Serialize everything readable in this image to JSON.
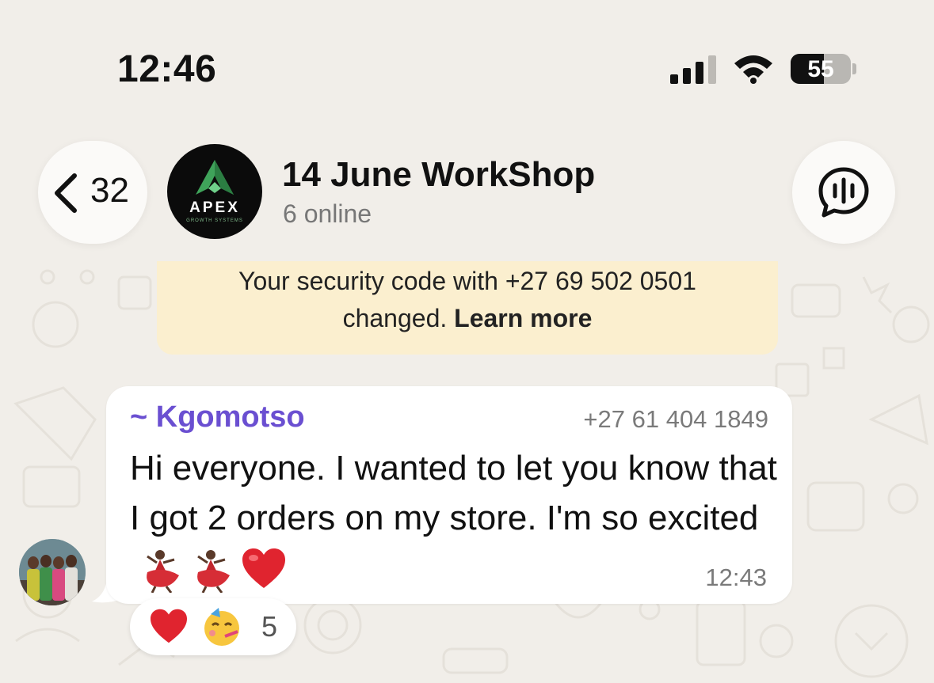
{
  "status_bar": {
    "time": "12:46",
    "battery": "55",
    "battery_level": 0.55,
    "signal_bars": 3
  },
  "header": {
    "back_count": "32",
    "chat_title": "14 June WorkShop",
    "chat_subtitle": "6 online",
    "avatar_logo": {
      "name": "APEX",
      "tagline": "GROWTH SYSTEMS"
    }
  },
  "security_notice": {
    "text_line1": "Your security code with +27 69 502 0501",
    "text_line2": "changed.",
    "link": "Learn more"
  },
  "message": {
    "sender": "~ Kgomotso",
    "sender_phone": "+27 61 404 1849",
    "text": "Hi everyone. I wanted to let you know that I got 2 orders on my store.  I'm so excited",
    "emojis": [
      "dancer",
      "dancer",
      "heart"
    ],
    "time": "12:43"
  },
  "reactions": {
    "items": [
      "heart",
      "partying-face"
    ],
    "count": "5"
  },
  "colors": {
    "sender": "#6a4fd1",
    "notice_bg": "#fbefcf",
    "background": "#f1eee9"
  }
}
